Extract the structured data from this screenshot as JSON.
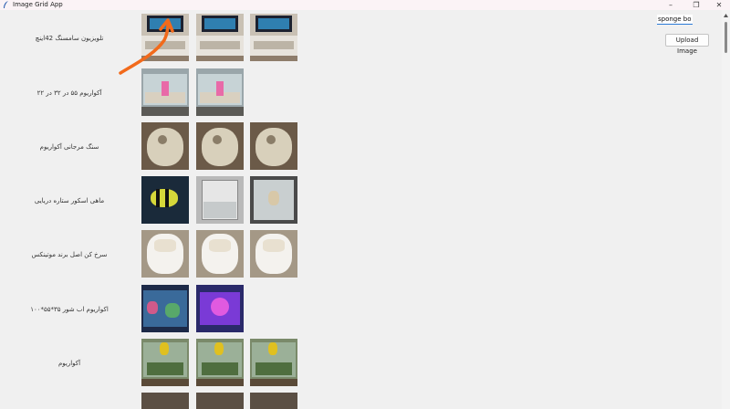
{
  "window": {
    "title": "Image Grid App",
    "buttons": {
      "minimize": "–",
      "maximize": "❐",
      "close": "✕"
    }
  },
  "search": {
    "value": "sponge bob"
  },
  "upload_button": {
    "label": "Upload Image"
  },
  "rows": [
    {
      "label": "تلویزیون سامسنگ 42اینچ",
      "thumbs": [
        "tv-stand-white",
        "tv-stand-white",
        "tv-stand-white"
      ]
    },
    {
      "label": "آکواریوم ۵۵ در ۳۲ در ۲۲",
      "thumbs": [
        "aquarium-tank",
        "aquarium-tank"
      ]
    },
    {
      "label": "سنگ مرجانی آکواریوم",
      "thumbs": [
        "coral-stone",
        "coral-stone",
        "coral-stone"
      ]
    },
    {
      "label": "ماهی اسکور ستاره دریایی",
      "thumbs": [
        "tropical-fish",
        "glass-tank",
        "starfish"
      ]
    },
    {
      "label": "سرخ کن اصل برند موتینکس",
      "thumbs": [
        "air-fryer",
        "air-fryer",
        "air-fryer"
      ]
    },
    {
      "label": "اکواریوم اب شور ۳۵*۵۵*۱۰۰",
      "thumbs": [
        "reef-aquarium",
        "reef-aquarium-purple"
      ]
    },
    {
      "label": "آکواریوم",
      "thumbs": [
        "planted-aquarium",
        "planted-aquarium",
        "planted-aquarium"
      ]
    }
  ],
  "colors": {
    "accent": "#2a7ad6",
    "annotation": "#f26a1b"
  }
}
